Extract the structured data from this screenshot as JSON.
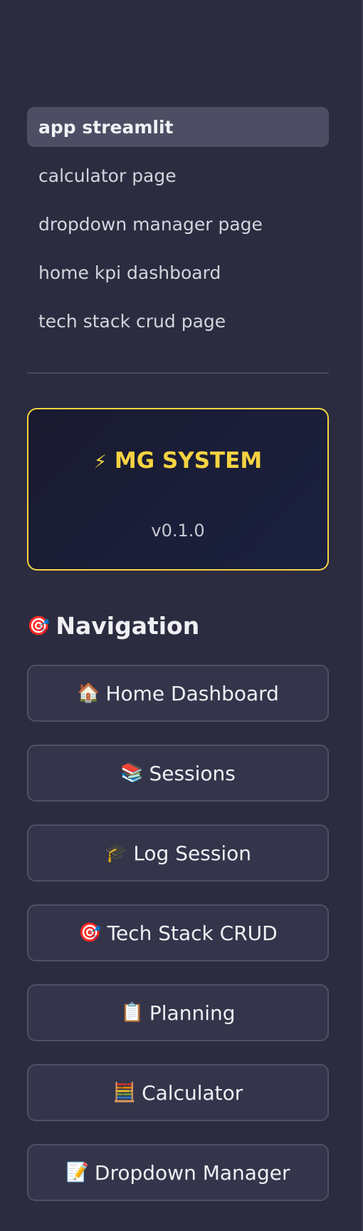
{
  "pages": [
    {
      "label": "app streamlit",
      "active": true
    },
    {
      "label": "calculator page",
      "active": false
    },
    {
      "label": "dropdown manager page",
      "active": false
    },
    {
      "label": "home kpi dashboard",
      "active": false
    },
    {
      "label": "tech stack crud page",
      "active": false
    }
  ],
  "brand": {
    "icon": "⚡",
    "title": "MG SYSTEM",
    "version": "v0.1.0",
    "accent_color": "#f5d342"
  },
  "navigation": {
    "icon": "🎯",
    "heading": "Navigation",
    "buttons": [
      {
        "icon": "🏠",
        "icon_name": "home-icon",
        "label": "Home Dashboard"
      },
      {
        "icon": "📚",
        "icon_name": "books-icon",
        "label": "Sessions"
      },
      {
        "icon": "🎓",
        "icon_name": "graduation-cap-icon",
        "label": "Log Session"
      },
      {
        "icon": "🎯",
        "icon_name": "target-icon",
        "label": "Tech Stack CRUD"
      },
      {
        "icon": "📋",
        "icon_name": "clipboard-icon",
        "label": "Planning"
      },
      {
        "icon": "🧮",
        "icon_name": "abacus-icon",
        "label": "Calculator"
      },
      {
        "icon": "📝",
        "icon_name": "memo-icon",
        "label": "Dropdown Manager"
      }
    ]
  }
}
